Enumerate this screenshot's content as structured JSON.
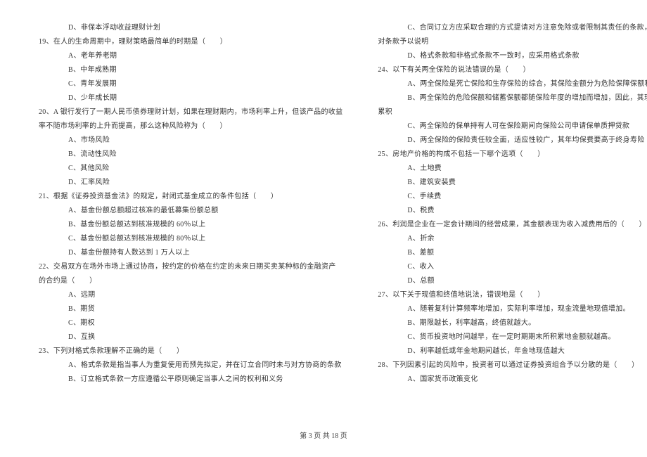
{
  "left": {
    "l1": "D、非保本浮动收益理财计划",
    "q19": "19、在人的生命周期中，理财策略最简单的时期是（　　）",
    "q19a": "A、老年养老期",
    "q19b": "B、中年成熟期",
    "q19c": "C、青年发展期",
    "q19d": "D、少年成长期",
    "q20_1": "20、A 银行发行了一期人民币债券理财计划，如果在理财期内，市场利率上升，但该产品的收益",
    "q20_2": "率不随市场利率的上升而提高，那么这种风险称为（　　）",
    "q20a": "A、市场风险",
    "q20b": "B、流动性风险",
    "q20c": "C、其他风险",
    "q20d": "D、汇率风险",
    "q21": "21、根据《证券投资基金法》的规定，封闭式基金成立的条件包括（　　）",
    "q21a": "A、基金份额总额超过核准的最低募集份额总额",
    "q21b": "B、基金份额总额达到核准规模的 60％以上",
    "q21c": "C、基金份额总额达到核准规模的 80％以上",
    "q21d": "D、基金份额持有人数达到 1 万人以上",
    "q22_1": "22、交易双方在场外市场上通过协商，按约定的价格在约定的未来日期买卖某种标的金融资产",
    "q22_2": "的合约是（　　）",
    "q22a": "A、远期",
    "q22b": "B、期货",
    "q22c": "C、期权",
    "q22d": "D、互换",
    "q23": "23、下列对格式条款理解不正确的是（　　）",
    "q23a": "A、格式条款是指当事人为重复使用而预先拟定，并在订立合同时未与对方协商的条款",
    "q23b": "B、订立格式条款一方应遵循公平原则确定当事人之间的权利和义务"
  },
  "right": {
    "q23c_1": "C、合同订立方应采取合理的方式提请对方注意免除或者限制其责任的条款，按对方要求，",
    "q23c_2": "对条款予以说明",
    "q23d": "D、格式条款和非格式条款不一致时，应采用格式条款",
    "q24": "24、以下有关两全保险的说法错误的是（　　）",
    "q24a": "A、两全保险是死亡保险和生存保险的综合，其保险金额分为危险保障保额和储蓄保额",
    "q24b_1": "B、两全保险的危险保额和储蓄保额都随保险年度的增加而增加，因此，其现金价值也逐渐",
    "q24b_2": "累积",
    "q24c": "C、两全保险的保单持有人可在保险期间向保险公司申请保单质押贷款",
    "q24d": "D、两全保险的保险责任较全面，适应性较广，其年均保费要高于终身寿险",
    "q25": "25、房地产价格的构成不包括一下哪个选项（　　）",
    "q25a": "A、土地费",
    "q25b": "B、建筑安装费",
    "q25c": "C、手续费",
    "q25d": "D、税费",
    "q26": "26、利润是企业在一定会计期间的经营成果，其金额表现为收入减费用后的（　　）",
    "q26a": "A、折余",
    "q26b": "B、差额",
    "q26c": "C、收入",
    "q26d": "D、总额",
    "q27": "27、以下关于现值和终值地说法，错误地是（　　）",
    "q27a": "A、随着复利计算频率地增加，实际利率增加，现金流量地现值增加。",
    "q27b": "B、期限越长，利率越高，终值就越大。",
    "q27c": "C、货币投资地时间越早，在一定时期期末所积累地金额就越高。",
    "q27d": "D、利率越低或年金地期间越长，年金地现值越大",
    "q28": "28、下列因素引起的风险中，投资者可以通过证券投资组合予以分散的是（　　）",
    "q28a": "A、国家货币政策变化"
  },
  "footer": "第 3 页 共 18 页"
}
